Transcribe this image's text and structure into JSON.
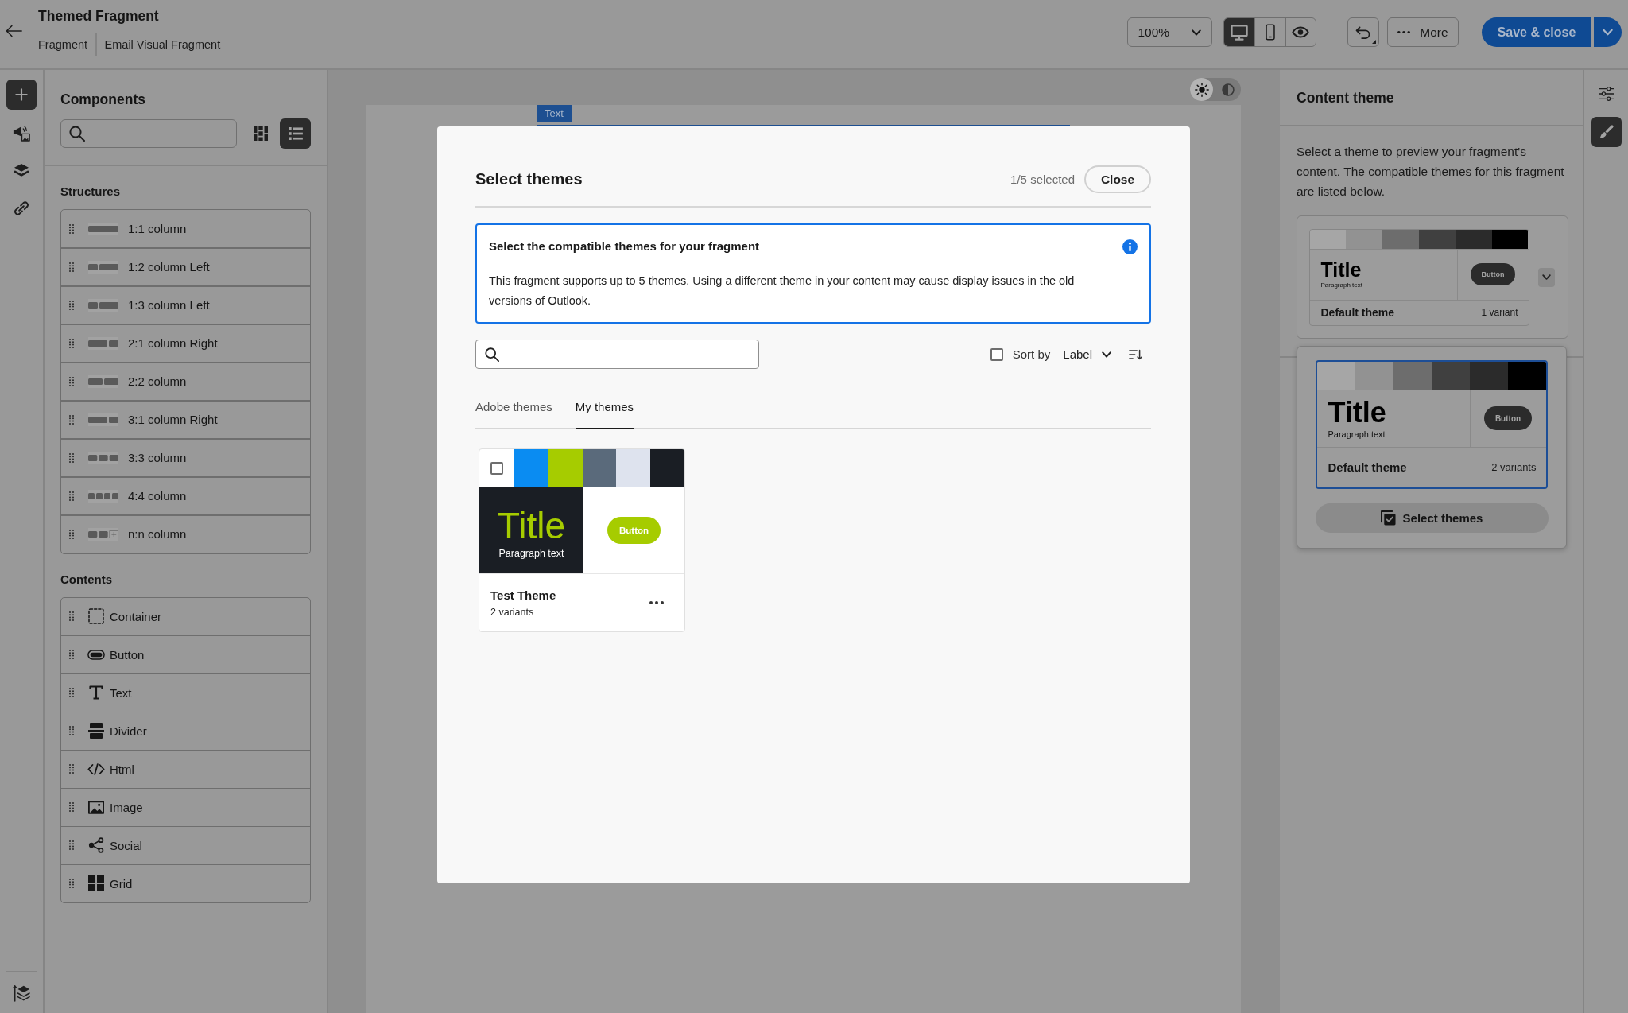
{
  "header": {
    "title": "Themed Fragment",
    "breadcrumbs": [
      "Fragment",
      "Email Visual Fragment"
    ]
  },
  "toolbar": {
    "zoom": "100%",
    "views": [
      {
        "kind": "desktop",
        "selected": true
      },
      {
        "kind": "mobile",
        "selected": false
      },
      {
        "kind": "preview",
        "selected": false
      }
    ],
    "more": "More",
    "save": "Save & close"
  },
  "left_rail": [
    {
      "kind": "add",
      "selected": true
    },
    {
      "kind": "assets",
      "selected": false
    },
    {
      "kind": "layers",
      "selected": false
    },
    {
      "kind": "links",
      "selected": false
    }
  ],
  "components": {
    "title": "Components",
    "view_modes": [
      {
        "kind": "grid",
        "selected": false
      },
      {
        "kind": "list",
        "selected": true
      }
    ],
    "sections": [
      {
        "title": "Structures",
        "items": [
          {
            "label": "1:1 column",
            "kind": "single"
          },
          {
            "label": "1:2 column Left",
            "kind": "left"
          },
          {
            "label": "1:3 column Left",
            "kind": "left"
          },
          {
            "label": "2:1 column Right",
            "kind": "right"
          },
          {
            "label": "2:2 column",
            "kind": "halves"
          },
          {
            "label": "3:1 column Right",
            "kind": "right"
          },
          {
            "label": "3:3 column",
            "kind": "thirds"
          },
          {
            "label": "4:4 column",
            "kind": "quarters"
          },
          {
            "label": "n:n column",
            "kind": "custom"
          }
        ]
      },
      {
        "title": "Contents",
        "items": [
          {
            "label": "Container",
            "kind": "container"
          },
          {
            "label": "Button",
            "kind": "button"
          },
          {
            "label": "Text",
            "kind": "text"
          },
          {
            "label": "Divider",
            "kind": "divider"
          },
          {
            "label": "Html",
            "kind": "html"
          },
          {
            "label": "Image",
            "kind": "image"
          },
          {
            "label": "Social",
            "kind": "social"
          },
          {
            "label": "Grid",
            "kind": "grid"
          }
        ]
      }
    ]
  },
  "canvas": {
    "block_label": "Text",
    "appearance": [
      {
        "kind": "light",
        "selected": true
      },
      {
        "kind": "dark",
        "selected": false
      }
    ]
  },
  "content_theme": {
    "title": "Content theme",
    "description": "Select a theme to preview your fragment's content. The compatible themes for this fragment are listed below.",
    "current": {
      "name": "Default theme",
      "variants": "1 variant",
      "swatches": [
        {
          "color": "#a6a6a6"
        },
        {
          "color": "#929292"
        },
        {
          "color": "#6d6d6d"
        },
        {
          "color": "#404040"
        },
        {
          "color": "#2b2b2b"
        },
        {
          "color": "#000000"
        }
      ],
      "preview": {
        "title": "Title",
        "paragraph": "Paragraph text",
        "button": "Button"
      }
    },
    "menu": {
      "expanded": true,
      "options": [
        {
          "name": "Default theme",
          "variants": "2 variants",
          "selected": true,
          "swatches": [
            {
              "color": "#a6a6a6"
            },
            {
              "color": "#929292"
            },
            {
              "color": "#6d6d6d"
            },
            {
              "color": "#404040"
            },
            {
              "color": "#2b2b2b"
            },
            {
              "color": "#000000"
            }
          ],
          "preview": {
            "title": "Title",
            "paragraph": "Paragraph text",
            "button": "Button"
          }
        }
      ],
      "action": "Select themes"
    }
  },
  "right_rail": [
    {
      "kind": "properties",
      "selected": false
    },
    {
      "kind": "theme",
      "selected": true
    }
  ],
  "dialog": {
    "title": "Select themes",
    "count": "1/5 selected",
    "close": "Close",
    "notice": {
      "title": "Select the compatible themes for your fragment",
      "body": "This fragment supports up to 5 themes. Using a different theme in your content may cause display issues in the old versions of Outlook."
    },
    "select_all": {
      "checked": false
    },
    "sort": {
      "label": "Sort by",
      "value": "Label"
    },
    "tabs": [
      {
        "label": "Adobe themes",
        "selected": false
      },
      {
        "label": "My themes",
        "selected": true
      }
    ],
    "themes": [
      {
        "name": "Test Theme",
        "variants": "2 variants",
        "checked": false,
        "swatches": [
          {
            "color": "#0a8cf2"
          },
          {
            "color": "#a6cc00"
          },
          {
            "color": "#5a6a7b"
          },
          {
            "color": "#dee3ee"
          },
          {
            "color": "#1a1e24"
          }
        ],
        "preview": {
          "title": "Title",
          "paragraph": "Paragraph text",
          "button": "Button"
        }
      }
    ]
  }
}
